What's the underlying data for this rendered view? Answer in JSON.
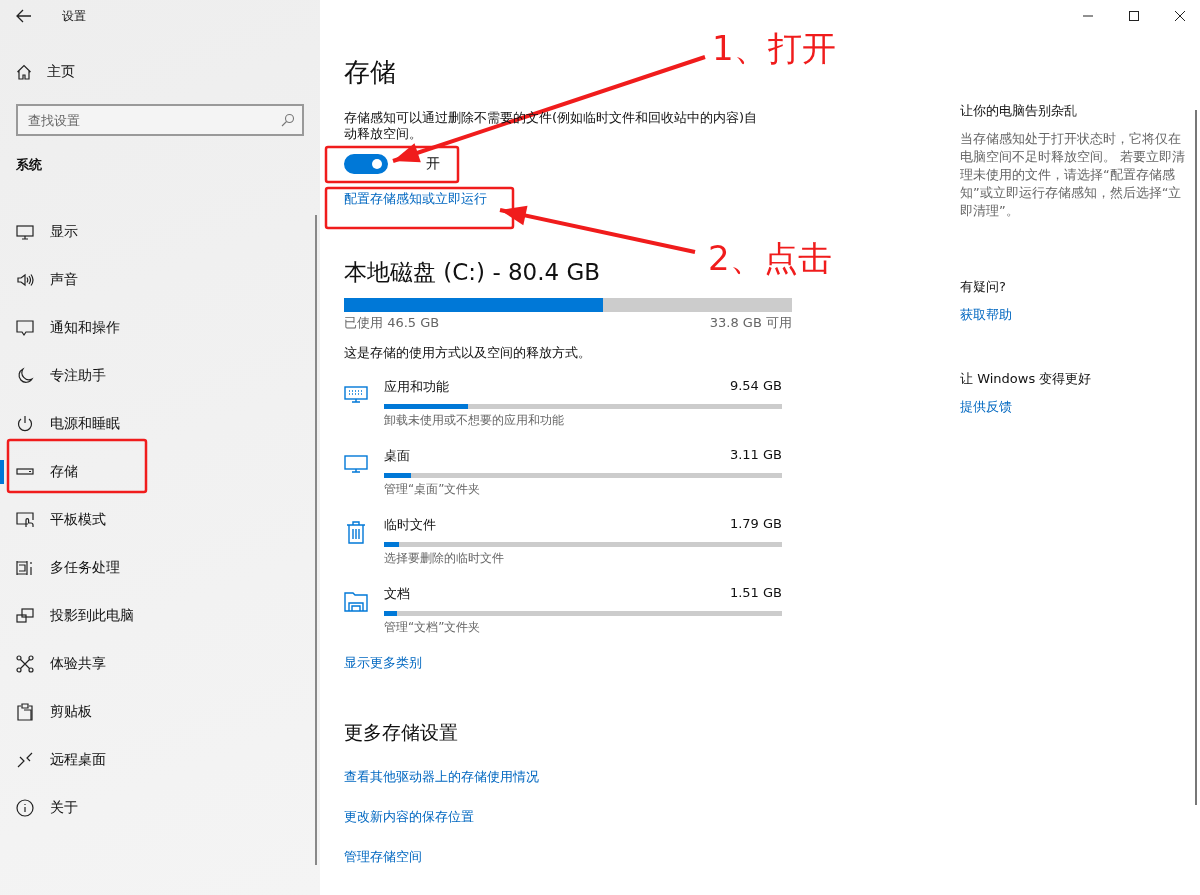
{
  "window": {
    "title": "设置"
  },
  "sidebar": {
    "home": "主页",
    "search": {
      "placeholder": "查找设置"
    },
    "section": "系统",
    "items": [
      {
        "label": "显示",
        "selected": false
      },
      {
        "label": "声音",
        "selected": false
      },
      {
        "label": "通知和操作",
        "selected": false
      },
      {
        "label": "专注助手",
        "selected": false
      },
      {
        "label": "电源和睡眠",
        "selected": false
      },
      {
        "label": "存储",
        "selected": true
      },
      {
        "label": "平板模式",
        "selected": false
      },
      {
        "label": "多任务处理",
        "selected": false
      },
      {
        "label": "投影到此电脑",
        "selected": false
      },
      {
        "label": "体验共享",
        "selected": false
      },
      {
        "label": "剪贴板",
        "selected": false
      },
      {
        "label": "远程桌面",
        "selected": false
      },
      {
        "label": "关于",
        "selected": false
      }
    ]
  },
  "main": {
    "title": "存储",
    "description": "存储感知可以通过删除不需要的文件(例如临时文件和回收站中的内容)自动释放空间。",
    "toggle": {
      "on": true,
      "label": "开"
    },
    "configure_link": "配置存储感知或立即运行",
    "disk": {
      "title": "本地磁盘 (C:) - 80.4 GB",
      "level": 0.578,
      "used": "已使用 46.5 GB",
      "free": "33.8 GB 可用"
    },
    "usage_note": "这是存储的使用方式以及空间的释放方式。",
    "categories": [
      {
        "kind": "apps",
        "name": "应用和功能",
        "size": "9.54 GB",
        "level": 0.21,
        "hint": "卸载未使用或不想要的应用和功能"
      },
      {
        "kind": "desktop",
        "name": "桌面",
        "size": "3.11 GB",
        "level": 0.068,
        "hint": "管理“桌面”文件夹"
      },
      {
        "kind": "temp",
        "name": "临时文件",
        "size": "1.79 GB",
        "level": 0.038,
        "hint": "选择要删除的临时文件"
      },
      {
        "kind": "documents",
        "name": "文档",
        "size": "1.51 GB",
        "level": 0.033,
        "hint": "管理“文档”文件夹"
      }
    ],
    "more_link": "显示更多类别",
    "more_title": "更多存储设置",
    "more_links": [
      "查看其他驱动器上的存储使用情况",
      "更改新内容的保存位置",
      "管理存储空间"
    ]
  },
  "aside": {
    "sections": [
      {
        "title": "让你的电脑告别杂乱",
        "text": "当存储感知处于打开状态时，它将仅在电脑空间不足时释放空间。 若要立即清理未使用的文件，请选择“配置存储感知”或立即运行存储感知，然后选择“立即清理”。"
      },
      {
        "title": "有疑问?",
        "link": "获取帮助"
      },
      {
        "title": "让 Windows 变得更好",
        "link": "提供反馈"
      }
    ]
  },
  "annotations": [
    {
      "label": "1、打开"
    },
    {
      "label": "2、点击"
    }
  ]
}
